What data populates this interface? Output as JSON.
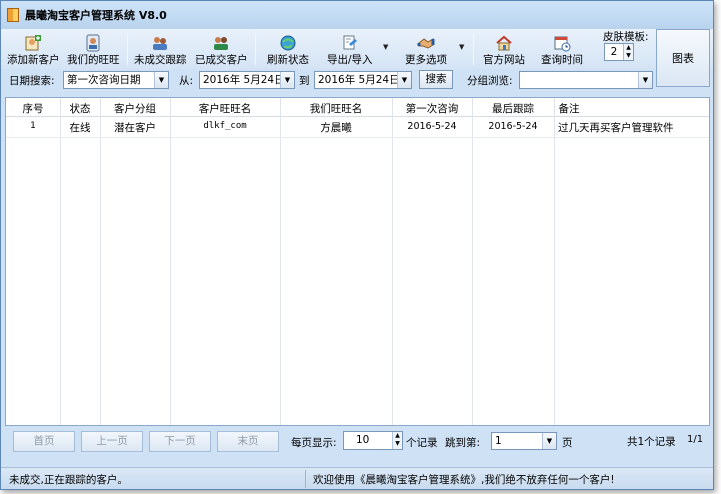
{
  "window": {
    "title": "晨曦淘宝客户管理系统 V8.0"
  },
  "toolbar": {
    "add_customer": "添加新客户",
    "our_wangwang": "我们的旺旺",
    "pending_follow": "未成交跟踪",
    "closed_customers": "已成交客户",
    "refresh_status": "刷新状态",
    "export_import": "导出/导入",
    "more_options": "更多选项",
    "official_site": "官方网站",
    "query_time": "查询时间",
    "skin_label": "皮肤模板:",
    "skin_value": "2",
    "chart_button": "图表"
  },
  "filter": {
    "date_search_label": "日期搜索:",
    "date_field": "第一次咨询日期",
    "from_label": "从:",
    "from_date": "2016年 5月24日",
    "to_label": "到",
    "to_date": "2016年 5月24日",
    "search_button": "搜索",
    "group_label": "分组浏览:",
    "group_value": ""
  },
  "table": {
    "headers": [
      "序号",
      "状态",
      "客户分组",
      "客户旺旺名",
      "我们旺旺名",
      "第一次咨询",
      "最后跟踪",
      "备注"
    ],
    "rows": [
      [
        "1",
        "在线",
        "潜在客户",
        "dlkf_com",
        "方晨曦",
        "2016-5-24",
        "2016-5-24",
        "过几天再买客户管理软件"
      ]
    ]
  },
  "pager": {
    "first": "首页",
    "prev": "上一页",
    "next": "下一页",
    "last": "末页",
    "per_page_label": "每页显示:",
    "per_page_value": "10",
    "per_page_suffix": "个记录",
    "jump_label": "跳到第:",
    "jump_value": "1",
    "page_suffix": "页",
    "total_records": "共1个记录",
    "page_of": "1/1"
  },
  "status": {
    "left": "未成交,正在跟踪的客户。",
    "right": "欢迎使用《晨曦淘宝客户管理系统》,我们绝不放弃任何一个客户!"
  }
}
